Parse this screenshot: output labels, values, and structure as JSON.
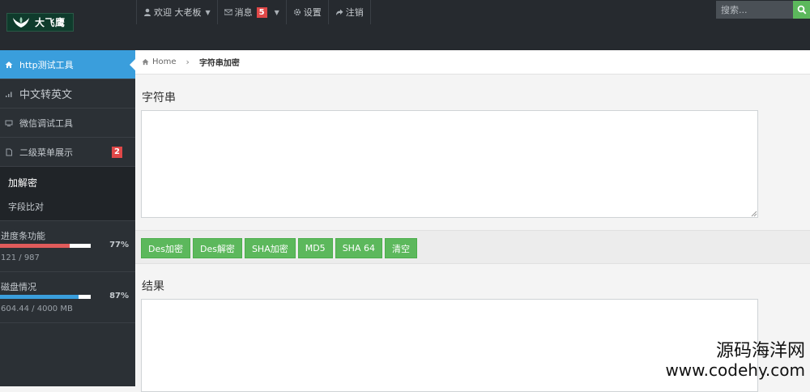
{
  "brand": {
    "name": "大飞鹰"
  },
  "nav": {
    "welcome": "欢迎 大老板",
    "messages": "消息",
    "messages_count": "5",
    "settings": "设置",
    "logout": "注销"
  },
  "search": {
    "placeholder": "搜索..."
  },
  "sidebar": {
    "items": [
      {
        "label": "http测试工具"
      },
      {
        "label": "中文转英文"
      },
      {
        "label": "微信调试工具"
      },
      {
        "label": "二级菜单展示",
        "badge": "2"
      }
    ],
    "submenu": [
      {
        "label": "加解密"
      },
      {
        "label": "字段比对"
      }
    ],
    "stats": [
      {
        "label": "进度条功能",
        "percent_text": "77%",
        "value": 0.77,
        "detail": "121 / 987",
        "color": "#e05b5b"
      },
      {
        "label": "磁盘情况",
        "percent_text": "87%",
        "value": 0.87,
        "detail": "604.44 / 4000 MB",
        "color": "#3a9edc"
      }
    ]
  },
  "breadcrumb": {
    "home": "Home",
    "current": "字符串加密"
  },
  "main": {
    "input_label": "字符串",
    "output_label": "结果",
    "buttons": [
      "Des加密",
      "Des解密",
      "SHA加密",
      "MD5",
      "SHA 64",
      "清空"
    ]
  },
  "watermark": {
    "cn": "源码海洋网",
    "url": "www.codehy.com"
  }
}
